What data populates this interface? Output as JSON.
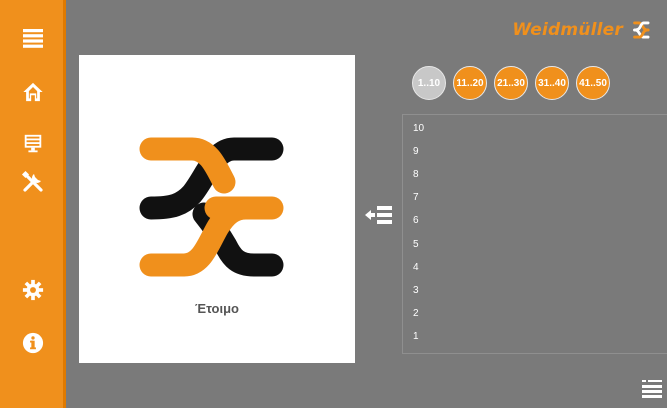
{
  "brand": {
    "name": "Weidmüller"
  },
  "sidebar": {
    "items": [
      {
        "id": "menu",
        "icon": "hamburger-menu-icon"
      },
      {
        "id": "home",
        "icon": "home-icon"
      },
      {
        "id": "monitor",
        "icon": "monitor-icon"
      },
      {
        "id": "tools",
        "icon": "tools-icon"
      },
      {
        "id": "settings",
        "icon": "gear-icon"
      },
      {
        "id": "info",
        "icon": "info-icon"
      }
    ]
  },
  "status": {
    "label": "Έτοιμο",
    "icon": "weidmuller-logo-icon"
  },
  "ranges": {
    "active_index": 0,
    "tabs": [
      {
        "label": "1..10"
      },
      {
        "label": "11..20"
      },
      {
        "label": "21..30"
      },
      {
        "label": "31..40"
      },
      {
        "label": "41..50"
      }
    ]
  },
  "slots": {
    "rows": [
      "10",
      "9",
      "8",
      "7",
      "6",
      "5",
      "4",
      "3",
      "2",
      "1"
    ]
  },
  "colors": {
    "accent": "#f0901c",
    "background": "#7a7a7a",
    "panel": "#ffffff",
    "inactive_tab": "#c8c8c8",
    "logo_dark": "#111111"
  }
}
